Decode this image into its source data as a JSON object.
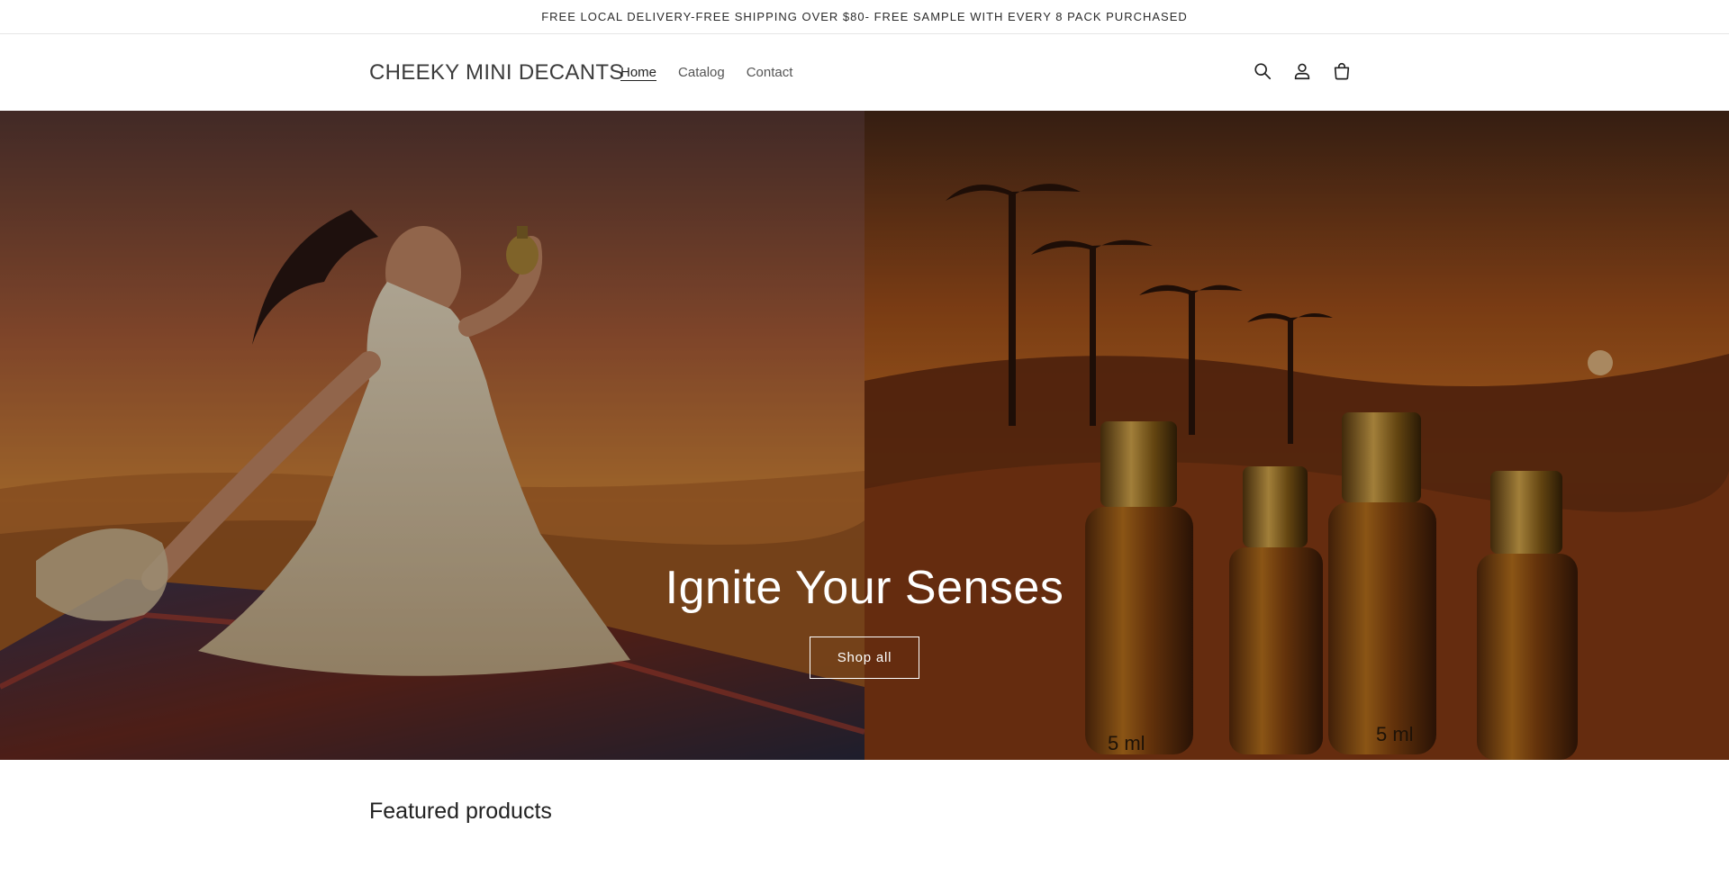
{
  "announcement": {
    "text": "FREE LOCAL DELIVERY-FREE SHIPPING OVER $80- FREE SAMPLE WITH EVERY 8 PACK PURCHASED"
  },
  "header": {
    "logo": "CHEEKY MINI DECANTS",
    "nav": [
      {
        "label": "Home",
        "active": true
      },
      {
        "label": "Catalog",
        "active": false
      },
      {
        "label": "Contact",
        "active": false
      }
    ],
    "icons": [
      "search-icon",
      "account-icon",
      "cart-icon"
    ]
  },
  "hero": {
    "title": "Ignite Your Senses",
    "button_label": "Shop all",
    "bottle_label": "5 ml",
    "colors": {
      "sky_top": "#5a3a2a",
      "sky_mid": "#c46a2a",
      "sand": "#8a4a1c",
      "bottle_gold": "#b07a2a"
    }
  },
  "featured": {
    "title": "Featured products"
  }
}
